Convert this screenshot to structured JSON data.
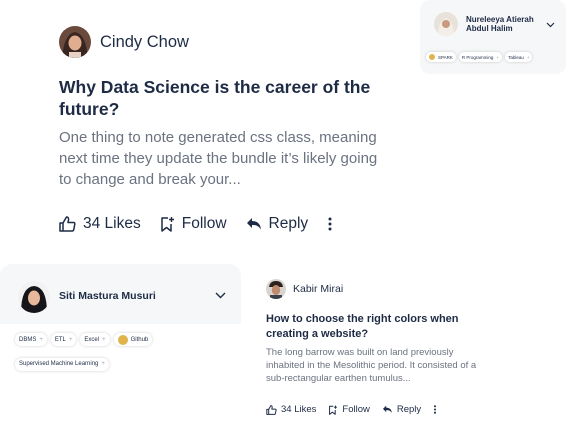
{
  "main_post": {
    "author": "Cindy Chow",
    "title": "Why Data Science is the career of the future?",
    "excerpt": "One thing to note generated css class, meaning next time they update the bundle it’s likely going to change and break your...",
    "likes_label": "34 Likes",
    "follow_label": "Follow",
    "reply_label": "Reply",
    "icons": [
      "thumbs-up-icon",
      "bookmark-plus-icon",
      "reply-arrow-icon",
      "more-vertical-icon"
    ]
  },
  "small_post": {
    "author": "Kabir Mirai",
    "title": "How to choose the right colors when creating a website?",
    "excerpt": "The long barrow was built on land previously inhabited in the Mesolithic period. It consisted of a sub-rectangular earthen tumulus...",
    "likes_label": "34 Likes",
    "follow_label": "Follow",
    "reply_label": "Reply"
  },
  "profile_top": {
    "name": "Nureleeya Atierah Abdul Halim",
    "tags": [
      {
        "label": "SPARK",
        "badge": true,
        "plus": false
      },
      {
        "label": "R Programming",
        "badge": false,
        "plus": true
      },
      {
        "label": "Tableau",
        "badge": false,
        "plus": true
      }
    ]
  },
  "profile_left": {
    "name": "Siti Mastura Musuri",
    "tags": [
      {
        "label": "DBMS",
        "badge": false,
        "plus": true
      },
      {
        "label": "ETL",
        "badge": false,
        "plus": true
      },
      {
        "label": "Excel",
        "badge": false,
        "plus": true
      },
      {
        "label": "Github",
        "badge": true,
        "plus": false
      },
      {
        "label": "Supervised Machine Learning",
        "badge": false,
        "plus": true
      }
    ]
  },
  "colors": {
    "text_primary": "#1e2b45",
    "text_secondary": "#6b7280",
    "card_background": "#f6f7f8",
    "badge": "#e0b34b"
  }
}
